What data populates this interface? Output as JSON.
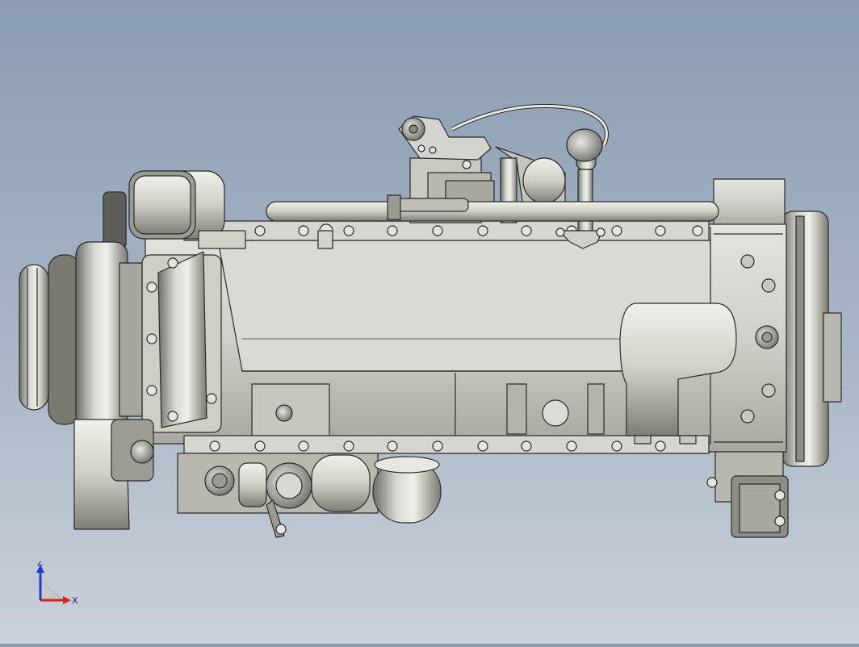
{
  "viewport": {
    "background_top": "#8a9cb2",
    "background_bottom": "#c9d0da",
    "model_fill": "#d4d4ce",
    "model_shade": "#9c9c94",
    "model_edge": "#2a2a28"
  },
  "triad": {
    "z_label": "Z",
    "x_label": "X",
    "z_color": "#1e3cc8",
    "x_color": "#d42020",
    "y_color": "#20a040"
  }
}
